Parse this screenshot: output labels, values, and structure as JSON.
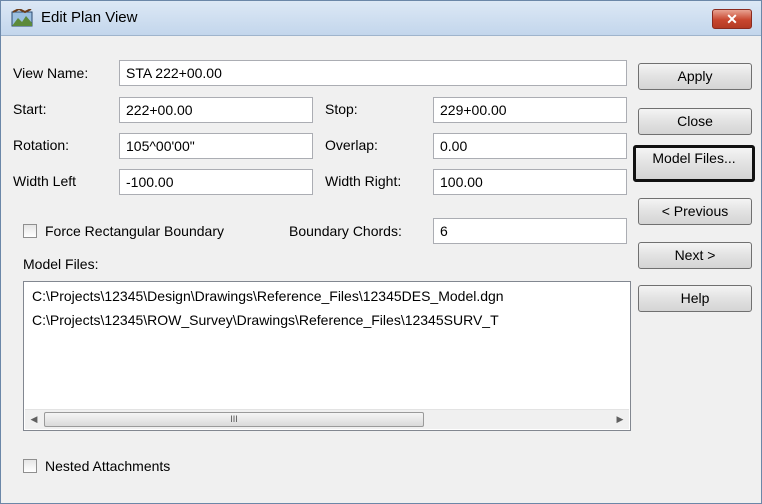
{
  "window": {
    "title": "Edit Plan View",
    "close_glyph": "✕"
  },
  "form": {
    "view_name": {
      "label": "View Name:",
      "value": "STA 222+00.00"
    },
    "start": {
      "label": "Start:",
      "value": "222+00.00"
    },
    "stop": {
      "label": "Stop:",
      "value": "229+00.00"
    },
    "rotation": {
      "label": "Rotation:",
      "value": "105^00'00\""
    },
    "overlap": {
      "label": "Overlap:",
      "value": "0.00"
    },
    "width_left": {
      "label": "Width Left",
      "value": "-100.00"
    },
    "width_right": {
      "label": "Width Right:",
      "value": "100.00"
    },
    "force_rect": {
      "label": "Force Rectangular Boundary",
      "checked": false
    },
    "boundary_chords": {
      "label": "Boundary Chords:",
      "value": "6"
    },
    "model_files_label": "Model Files:",
    "model_files": [
      "C:\\Projects\\12345\\Design\\Drawings\\Reference_Files\\12345DES_Model.dgn",
      "C:\\Projects\\12345\\ROW_Survey\\Drawings\\Reference_Files\\12345SURV_T"
    ],
    "nested": {
      "label": "Nested Attachments",
      "checked": false
    }
  },
  "buttons": {
    "apply": "Apply",
    "close": "Close",
    "model_files": "Model Files...",
    "previous": "< Previous",
    "next": "Next >",
    "help": "Help"
  },
  "scrollbar": {
    "left_arrow": "◀",
    "right_arrow": "▶",
    "grip": "III"
  },
  "icons": {
    "app": "map-icon"
  }
}
